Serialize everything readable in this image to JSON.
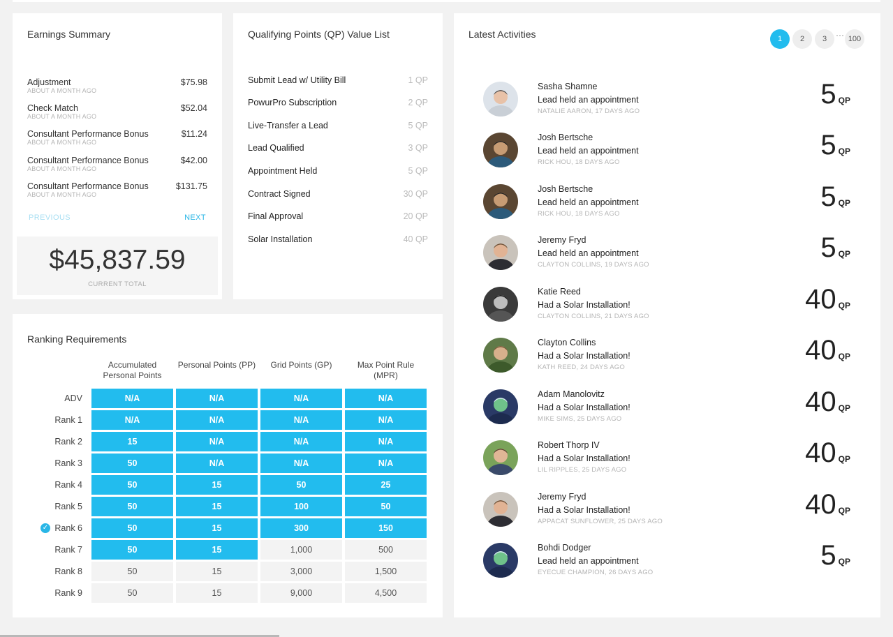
{
  "earnings": {
    "title": "Earnings Summary",
    "items": [
      {
        "label": "Adjustment",
        "time": "ABOUT A MONTH AGO",
        "amount": "$75.98"
      },
      {
        "label": "Check Match",
        "time": "ABOUT A MONTH AGO",
        "amount": "$52.04"
      },
      {
        "label": "Consultant Performance Bonus",
        "time": "ABOUT A MONTH AGO",
        "amount": "$11.24"
      },
      {
        "label": "Consultant Performance Bonus",
        "time": "ABOUT A MONTH AGO",
        "amount": "$42.00"
      },
      {
        "label": "Consultant Performance Bonus",
        "time": "ABOUT A MONTH AGO",
        "amount": "$131.75"
      }
    ],
    "previous_label": "PREVIOUS",
    "next_label": "NEXT",
    "total": "$45,837.59",
    "total_label": "CURRENT TOTAL"
  },
  "qp_list": {
    "title": "Qualifying Points (QP) Value List",
    "items": [
      {
        "name": "Submit Lead w/ Utility Bill",
        "value": "1 QP"
      },
      {
        "name": "PowurPro Subscription",
        "value": "2 QP"
      },
      {
        "name": "Live-Transfer a Lead",
        "value": "5 QP"
      },
      {
        "name": "Lead Qualified",
        "value": "3 QP"
      },
      {
        "name": "Appointment Held",
        "value": "5 QP"
      },
      {
        "name": "Contract Signed",
        "value": "30 QP"
      },
      {
        "name": "Final Approval",
        "value": "20 QP"
      },
      {
        "name": "Solar Installation",
        "value": "40 QP"
      }
    ]
  },
  "ranking": {
    "title": "Ranking Requirements",
    "columns": [
      "Accumulated Personal Points",
      "Personal Points (PP)",
      "Grid Points (GP)",
      "Max Point Rule (MPR)"
    ],
    "rows": [
      {
        "label": "ADV",
        "values": [
          "N/A",
          "N/A",
          "N/A",
          "N/A"
        ],
        "achieved": [
          true,
          true,
          true,
          true
        ],
        "current": false
      },
      {
        "label": "Rank 1",
        "values": [
          "N/A",
          "N/A",
          "N/A",
          "N/A"
        ],
        "achieved": [
          true,
          true,
          true,
          true
        ],
        "current": false
      },
      {
        "label": "Rank 2",
        "values": [
          "15",
          "N/A",
          "N/A",
          "N/A"
        ],
        "achieved": [
          true,
          true,
          true,
          true
        ],
        "current": false
      },
      {
        "label": "Rank 3",
        "values": [
          "50",
          "N/A",
          "N/A",
          "N/A"
        ],
        "achieved": [
          true,
          true,
          true,
          true
        ],
        "current": false
      },
      {
        "label": "Rank 4",
        "values": [
          "50",
          "15",
          "50",
          "25"
        ],
        "achieved": [
          true,
          true,
          true,
          true
        ],
        "current": false
      },
      {
        "label": "Rank 5",
        "values": [
          "50",
          "15",
          "100",
          "50"
        ],
        "achieved": [
          true,
          true,
          true,
          true
        ],
        "current": false
      },
      {
        "label": "Rank 6",
        "values": [
          "50",
          "15",
          "300",
          "150"
        ],
        "achieved": [
          true,
          true,
          true,
          true
        ],
        "current": true
      },
      {
        "label": "Rank 7",
        "values": [
          "50",
          "15",
          "1,000",
          "500"
        ],
        "achieved": [
          true,
          true,
          false,
          false
        ],
        "current": false
      },
      {
        "label": "Rank 8",
        "values": [
          "50",
          "15",
          "3,000",
          "1,500"
        ],
        "achieved": [
          false,
          false,
          false,
          false
        ],
        "current": false
      },
      {
        "label": "Rank 9",
        "values": [
          "50",
          "15",
          "9,000",
          "4,500"
        ],
        "achieved": [
          false,
          false,
          false,
          false
        ],
        "current": false
      }
    ],
    "accent_color": "#22bcee"
  },
  "activities": {
    "title": "Latest Activities",
    "pages": [
      "1",
      "2",
      "3",
      "100"
    ],
    "ellipsis": "···",
    "current_page": "1",
    "qp_unit": "QP",
    "items": [
      {
        "name": "Sasha Shamne",
        "description": "Lead held an appointment",
        "meta": "NATALIE AARON, 17 DAYS AGO",
        "points": "5",
        "avatar": "avatar-1"
      },
      {
        "name": "Josh Bertsche",
        "description": "Lead held an appointment",
        "meta": "RICK HOU, 18 DAYS AGO",
        "points": "5",
        "avatar": "avatar-2"
      },
      {
        "name": "Josh Bertsche",
        "description": "Lead held an appointment",
        "meta": "RICK HOU, 18 DAYS AGO",
        "points": "5",
        "avatar": "avatar-2"
      },
      {
        "name": "Jeremy Fryd",
        "description": "Lead held an appointment",
        "meta": "CLAYTON COLLINS, 19 DAYS AGO",
        "points": "5",
        "avatar": "avatar-3"
      },
      {
        "name": "Katie Reed",
        "description": "Had a Solar Installation!",
        "meta": "CLAYTON COLLINS, 21 DAYS AGO",
        "points": "40",
        "avatar": "avatar-4"
      },
      {
        "name": "Clayton Collins",
        "description": "Had a Solar Installation!",
        "meta": "KATH REED, 24 DAYS AGO",
        "points": "40",
        "avatar": "avatar-5"
      },
      {
        "name": "Adam Manolovitz",
        "description": "Had a Solar Installation!",
        "meta": "MIKE SIMS, 25 DAYS AGO",
        "points": "40",
        "avatar": "avatar-6"
      },
      {
        "name": "Robert Thorp IV",
        "description": "Had a Solar Installation!",
        "meta": "LIL RIPPLES, 25 DAYS AGO",
        "points": "40",
        "avatar": "avatar-7"
      },
      {
        "name": "Jeremy Fryd",
        "description": "Had a Solar Installation!",
        "meta": "APPACAT SUNFLOWER, 25 DAYS AGO",
        "points": "40",
        "avatar": "avatar-3"
      },
      {
        "name": "Bohdi Dodger",
        "description": "Lead held an appointment",
        "meta": "EYECUE CHAMPION, 26 DAYS AGO",
        "points": "5",
        "avatar": "avatar-6"
      }
    ]
  }
}
